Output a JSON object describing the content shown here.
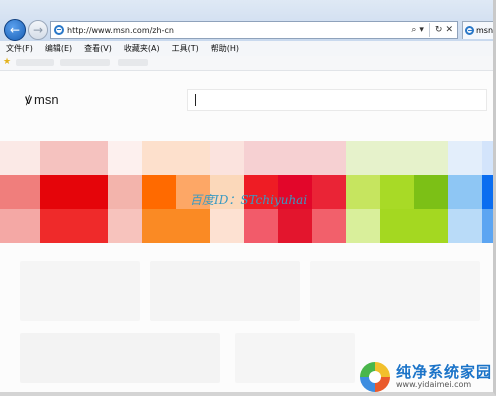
{
  "browser": {
    "url": "http://www.msn.com/zh-cn",
    "tab_title": "msn",
    "nav": {
      "back_glyph": "←",
      "forward_glyph": "→"
    },
    "addr_icons": {
      "search": "⌕",
      "dropdown": "▾",
      "refresh": "↻",
      "close": "✕"
    },
    "menu": [
      {
        "id": "file",
        "label": "文件(F)"
      },
      {
        "id": "edit",
        "label": "编辑(E)"
      },
      {
        "id": "view",
        "label": "查看(V)"
      },
      {
        "id": "favorites",
        "label": "收藏夹(A)"
      },
      {
        "id": "tools",
        "label": "工具(T)"
      },
      {
        "id": "help",
        "label": "帮助(H)"
      }
    ]
  },
  "page": {
    "logo_text": "msn",
    "watermark": "百度ID：STchiyuhai"
  },
  "colors": {
    "red": "#e5050a",
    "orange": "#ff6a00",
    "lime": "#a8da26",
    "blue": "#0a6df0"
  },
  "site_logo": {
    "name": "纯净系统家园",
    "url": "www.yidaimei.com"
  }
}
